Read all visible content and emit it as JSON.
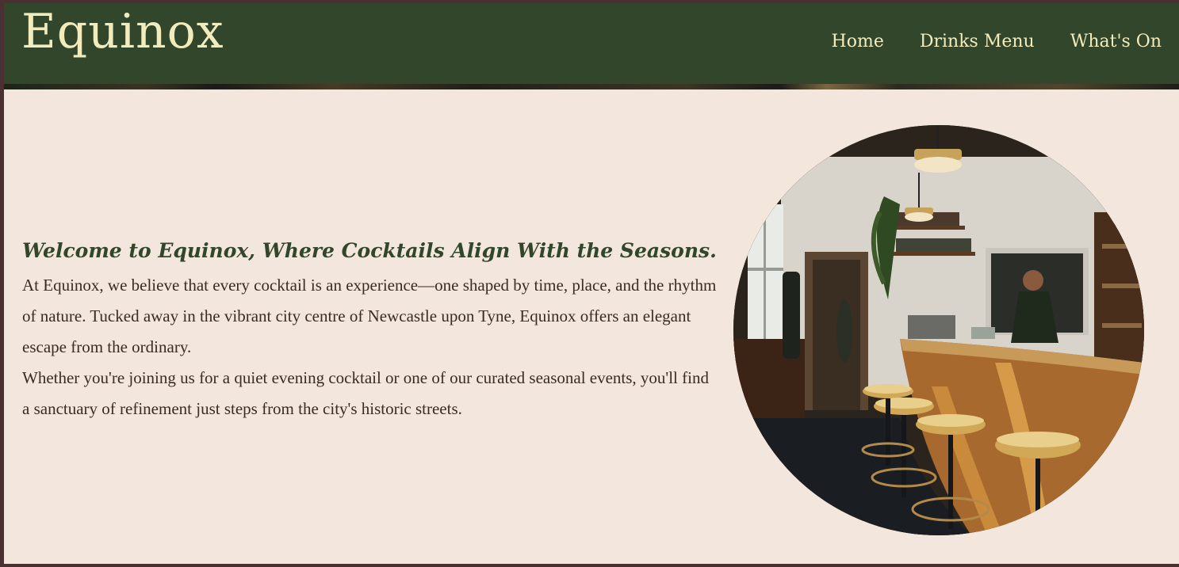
{
  "header": {
    "brand": "Equinox",
    "nav": [
      {
        "label": "Home"
      },
      {
        "label": "Drinks Menu"
      },
      {
        "label": "What's On"
      }
    ]
  },
  "intro": {
    "title": "Welcome to Equinox, Where Cocktails Align With the Seasons.",
    "paragraphs": [
      "At Equinox, we believe that every cocktail is an experience—one shaped by time, place, and the rhythm of nature. Tucked away in the vibrant city centre of Newcastle upon Tyne, Equinox offers an elegant escape from the ordinary.",
      "Whether you're joining us for a quiet evening cocktail or one of our curated seasonal events, you'll find a sanctuary of refinement just steps from the city's historic streets."
    ]
  },
  "colors": {
    "header_bg": "#31462a",
    "header_text": "#f2ecbd",
    "page_bg": "#f3e6dc",
    "title_text": "#31462a",
    "body_text": "#3a2b24"
  }
}
